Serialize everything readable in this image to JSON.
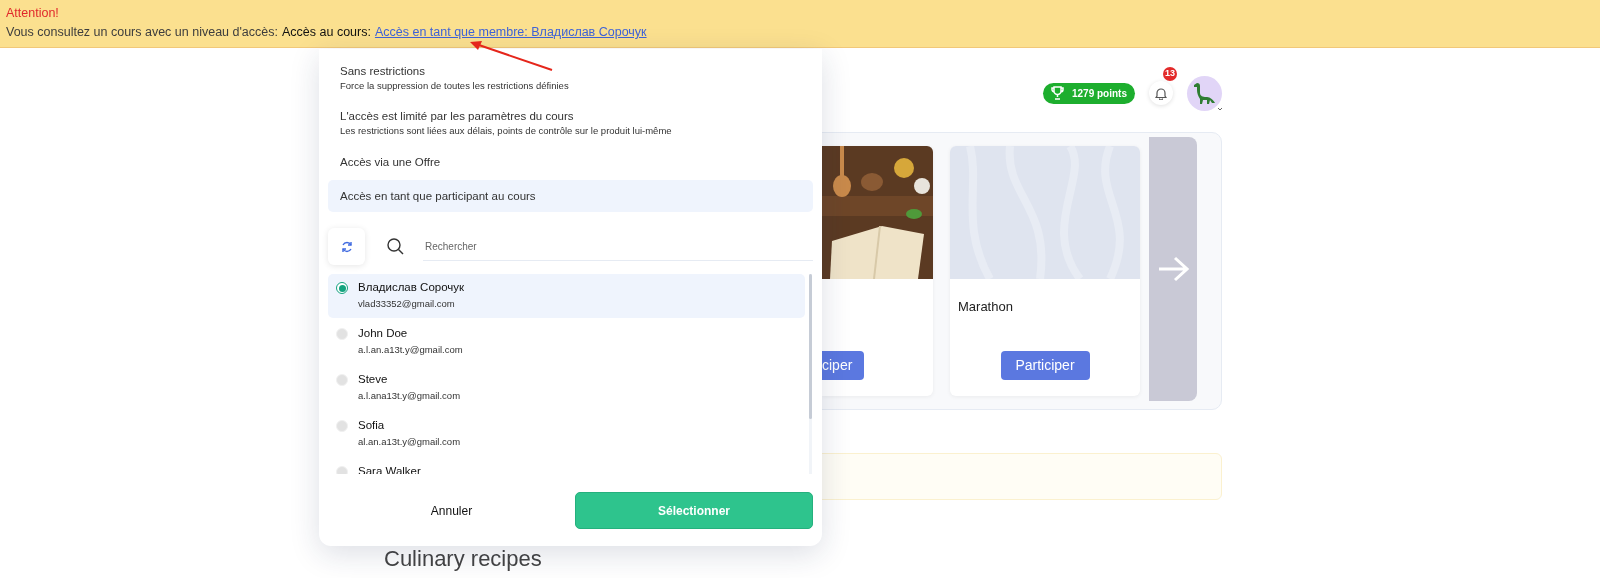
{
  "banner": {
    "title": "Attention!",
    "text": "Vous consultez un cours avec un niveau d'accès:",
    "access_label": "Accès au cours:",
    "link": "Accès en tant que membre: Владислав Сорочук"
  },
  "header": {
    "points": "1279 points",
    "notifications": "13"
  },
  "courses": [
    {
      "button": "ciper"
    },
    {
      "kind": "placeholder",
      "title": "Marathon",
      "button": "Participer"
    }
  ],
  "section_title": "Culinary recipes",
  "access_menu": {
    "options": [
      {
        "label": "Sans restrictions",
        "description": "Force la suppression de toutes les restrictions définies",
        "selected": false
      },
      {
        "label": "L'accès est limité par les paramètres du cours",
        "description": "Les restrictions sont liées aux délais, points de contrôle sur le produit lui-même",
        "selected": false
      },
      {
        "label": "Accès via une Offre",
        "selected": false
      },
      {
        "label": "Accès en tant que participant au cours",
        "selected": true
      }
    ],
    "search": {
      "placeholder": "Rechercher"
    },
    "members": [
      {
        "name": "Владислав Сорочук",
        "email": "vlad33352@gmail.com",
        "selected": true
      },
      {
        "name": "John Doe",
        "email": "a.l.an.a13t.y@gmail.com",
        "selected": false
      },
      {
        "name": "Steve",
        "email": "a.l.ana13t.y@gmail.com",
        "selected": false
      },
      {
        "name": "Sofia",
        "email": "al.an.a13t.y@gmail.com",
        "selected": false
      },
      {
        "name": "Sara Walker",
        "selected": false
      }
    ],
    "cancel": "Annuler",
    "confirm": "Sélectionner"
  }
}
